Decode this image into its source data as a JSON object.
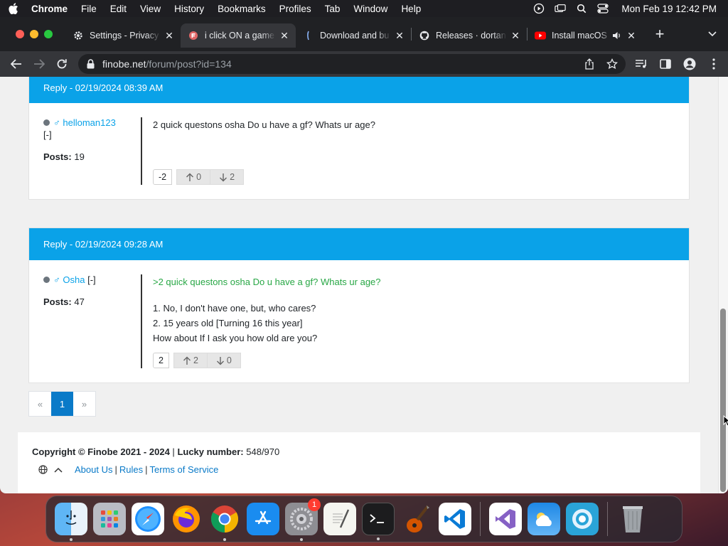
{
  "menubar": {
    "app_name": "Chrome",
    "items": [
      "File",
      "Edit",
      "View",
      "History",
      "Bookmarks",
      "Profiles",
      "Tab",
      "Window",
      "Help"
    ],
    "clock": "Mon Feb 19  12:42 PM"
  },
  "browser": {
    "tabs": [
      {
        "title": "Settings - Privacy",
        "icon": "gear-icon",
        "active": false
      },
      {
        "title": "i click ON a game",
        "icon": "finobe-icon",
        "active": true
      },
      {
        "title": "Download and bu",
        "icon": "feather-icon",
        "active": false
      },
      {
        "title": "Releases · dortan",
        "icon": "github-icon",
        "active": false
      },
      {
        "title": "Install macOS",
        "icon": "youtube-icon",
        "active": false
      }
    ],
    "address": {
      "domain": "finobe.net",
      "path": "/forum/post?id=134"
    }
  },
  "posts": [
    {
      "header": "Reply - 02/19/2024 08:39 AM",
      "gender_symbol": "♂",
      "username": "helloman123",
      "collapse": "[-]",
      "posts_label": "Posts:",
      "posts_count": "19",
      "quote": "",
      "lines": [
        "2 quick questons osha Do u have a gf? Whats ur age?"
      ],
      "score": "-2",
      "upvotes": "0",
      "downvotes": "2"
    },
    {
      "header": "Reply - 02/19/2024 09:28 AM",
      "gender_symbol": "♂",
      "username": "Osha",
      "collapse": "[-]",
      "posts_label": "Posts:",
      "posts_count": "47",
      "quote": ">2 quick questons osha Do u have a gf? Whats ur age?",
      "lines": [
        "1. No, I don't have one, but, who cares?",
        "2. 15 years old [Turning 16 this year]",
        "How about If I ask you how old are you?"
      ],
      "score": "2",
      "upvotes": "2",
      "downvotes": "0"
    }
  ],
  "pagination": {
    "prev": "«",
    "current": "1",
    "next": "»"
  },
  "footer": {
    "copyright_label": "Copyright © Finobe 2021 - 2024",
    "sep": "|",
    "lucky_label": "Lucky number:",
    "lucky_value": "548/970",
    "links": [
      "About Us",
      "Rules",
      "Terms of Service"
    ]
  },
  "dock": {
    "apps": [
      "finder-icon",
      "launchpad-icon",
      "safari-icon",
      "firefox-icon",
      "chrome-icon",
      "app-store-icon",
      "system-settings-icon",
      "textedit-icon",
      "terminal-icon",
      "garageband-icon",
      "vscode-icon",
      "visual-studio-icon",
      "weather-icon",
      "utility-icon",
      "trash-icon"
    ],
    "system_settings_badge": "1"
  },
  "colors": {
    "header_blue": "#0aa2e8",
    "link_blue": "#0a7ac8",
    "quote_green": "#28a745"
  }
}
